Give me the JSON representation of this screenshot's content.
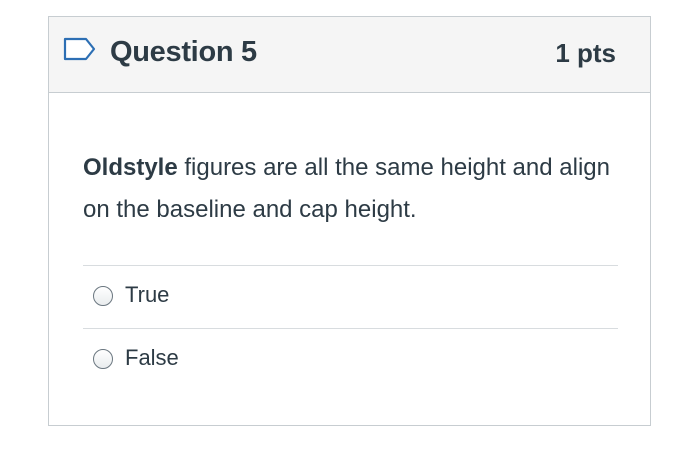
{
  "question": {
    "title": "Question 5",
    "points": "1 pts",
    "flag_icon": "flag-icon",
    "text_bold": "Oldstyle",
    "text_rest": " figures are all the same height and align on the baseline and cap height."
  },
  "answers": [
    {
      "label": "True",
      "selected": false
    },
    {
      "label": "False",
      "selected": false
    }
  ],
  "colors": {
    "header_bg": "#f5f5f5",
    "border": "#c7cdd1",
    "text": "#2d3b45",
    "flag": "#2d6fb4"
  }
}
